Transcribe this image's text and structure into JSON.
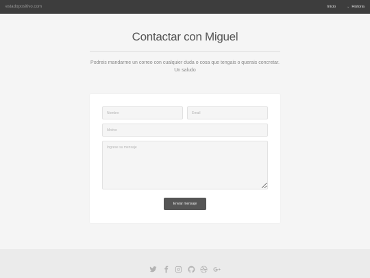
{
  "navbar": {
    "brand": "estadopositivo.com",
    "links": [
      {
        "label": "Inicio"
      },
      {
        "label": "Historia"
      }
    ]
  },
  "main": {
    "title": "Contactar con Miguel",
    "intro_line1": "Podreis mandarme un correo con cualquier duda o cosa que tengais o querais concretar.",
    "intro_line2": "Un saludo"
  },
  "form": {
    "name_placeholder": "Nombre",
    "email_placeholder": "Email",
    "subject_placeholder": "Motivo",
    "message_placeholder": "Ingrese su mensaje",
    "submit_label": "Enviar mensaje"
  },
  "footer": {
    "social_icons": [
      "twitter-icon",
      "facebook-icon",
      "instagram-icon",
      "github-icon",
      "dribbble-icon",
      "google-plus-icon"
    ]
  },
  "colors": {
    "navbar": "#3d3d3d",
    "background": "#f5f5f5",
    "card": "#ffffff",
    "button": "#555555",
    "footer": "#ebebeb"
  }
}
